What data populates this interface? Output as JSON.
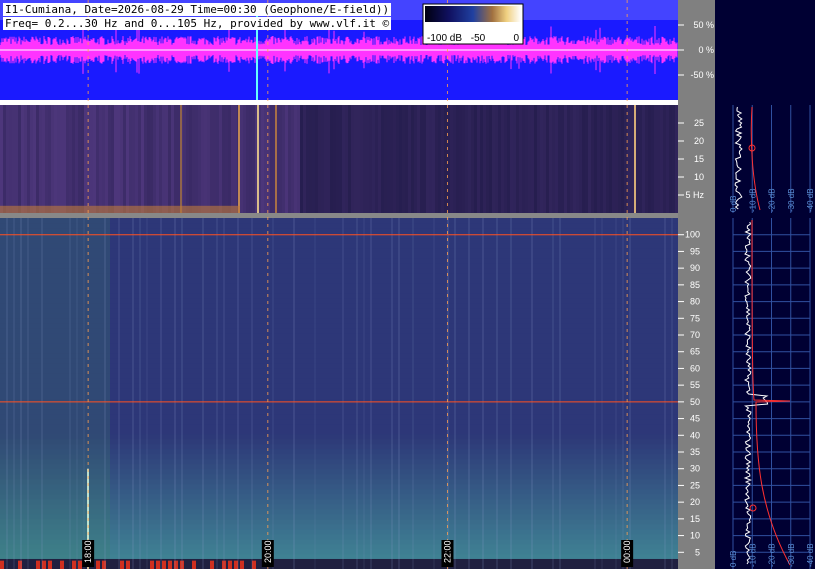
{
  "header": {
    "line1": "I1-Cumiana, Date=2026-08-29 Time=00:30 (Geophone/E-field))",
    "line2": "Freq= 0.2...30 Hz and 0...105 Hz, provided by www.vlf.it ©"
  },
  "colorbar": {
    "labels": [
      "-100 dB",
      "-50",
      "0"
    ]
  },
  "chart_data": [
    {
      "type": "area",
      "name": "amplitude-trace",
      "ylabel": "",
      "y_ticks": [
        "50 %",
        "0 %",
        "-50 %"
      ],
      "y_tick_values": [
        50,
        0,
        -50
      ],
      "ylim": [
        -100,
        100
      ],
      "colors": {
        "background": "#1a1aff",
        "trace": "#ff33ff",
        "top_band": "#4444ff"
      }
    },
    {
      "type": "heatmap",
      "name": "spectrogram-low",
      "ylim": [
        0,
        30
      ],
      "y_ticks": [
        "25",
        "20",
        "15",
        "10",
        "5 Hz"
      ],
      "y_tick_values": [
        25,
        20,
        15,
        10,
        5
      ]
    },
    {
      "type": "heatmap",
      "name": "spectrogram-high",
      "ylim": [
        0,
        105
      ],
      "y_ticks": [
        "100",
        "95",
        "90",
        "85",
        "80",
        "75",
        "70",
        "65",
        "60",
        "55",
        "50",
        "45",
        "40",
        "35",
        "30",
        "25",
        "20",
        "15",
        "10",
        "5"
      ],
      "y_tick_values": [
        100,
        95,
        90,
        85,
        80,
        75,
        70,
        65,
        60,
        55,
        50,
        45,
        40,
        35,
        30,
        25,
        20,
        15,
        10,
        5
      ],
      "hlines_hz": [
        100,
        50
      ],
      "x_ticks": [
        "18:00",
        "20:00",
        "22:00",
        "00:00"
      ],
      "x_tick_fractions": [
        0.13,
        0.395,
        0.66,
        0.925
      ]
    },
    {
      "type": "line",
      "name": "side-spectrum",
      "x_ticks": [
        "-40 dB",
        "-30 dB",
        "-20 dB",
        "-10 dB",
        "0 dB"
      ],
      "peaks_hz": [
        50,
        100
      ]
    }
  ]
}
